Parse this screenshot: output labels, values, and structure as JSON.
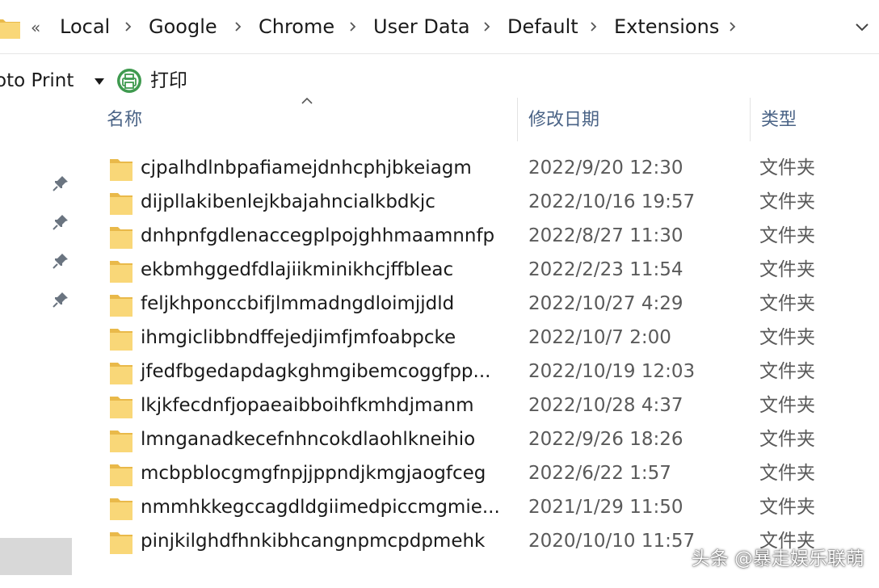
{
  "address_bar": {
    "overflow": "«",
    "crumbs": [
      "Local",
      "Google",
      "Chrome",
      "User Data",
      "Default",
      "Extensions"
    ]
  },
  "command_bar": {
    "photo_print_label": "oto Print",
    "print_label": "打印"
  },
  "columns": {
    "name": "名称",
    "date": "修改日期",
    "type": "类型"
  },
  "files": [
    {
      "name": "cjpalhdlnbpafiamejdnhcphjbkeiagm",
      "date": "2022/9/20 12:30",
      "type": "文件夹"
    },
    {
      "name": "dijpllakibenlejkbajahncialkbdkjc",
      "date": "2022/10/16 19:57",
      "type": "文件夹"
    },
    {
      "name": "dnhpnfgdlenaccegplpojghhmaamnnfp",
      "date": "2022/8/27 11:30",
      "type": "文件夹"
    },
    {
      "name": "ekbmhggedfdlajiikminikhcjffbleac",
      "date": "2022/2/23 11:54",
      "type": "文件夹"
    },
    {
      "name": "feljkhponccbifjlmmadngdloimjjdld",
      "date": "2022/10/27 4:29",
      "type": "文件夹"
    },
    {
      "name": "ihmgiclibbndffejedjimfjmfoabpcke",
      "date": "2022/10/7 2:00",
      "type": "文件夹"
    },
    {
      "name": "jfedfbgedapdagkghmgibemcoggfpp...",
      "date": "2022/10/19 12:03",
      "type": "文件夹"
    },
    {
      "name": "lkjkfecdnfjopaeaibboihfkmhdjmanm",
      "date": "2022/10/28 4:37",
      "type": "文件夹"
    },
    {
      "name": "lmnganadkecefnhncokdlaohlkneihio",
      "date": "2022/9/26 18:26",
      "type": "文件夹"
    },
    {
      "name": "mcbpblocgmgfnpjjppndjkmgjaogfceg",
      "date": "2022/6/22 1:57",
      "type": "文件夹"
    },
    {
      "name": "nmmhkkegccagdldgiimedpiccmgmie...",
      "date": "2021/1/29 11:50",
      "type": "文件夹"
    },
    {
      "name": "pinjkilghdfhnkibhcangnpmcpdpmehk",
      "date": "2020/10/10 11:57",
      "type": "文件夹"
    }
  ],
  "watermark": "头条 @暴走娱乐联萌",
  "colors": {
    "folder_body": "#f9d778",
    "folder_tab": "#e9b94a",
    "header_text": "#4a6386",
    "print_icon": "#3f9a4f"
  },
  "icons": {
    "folder": "folder-icon",
    "chevron": "chevron-right-icon",
    "pin": "pin-icon",
    "print": "printer-icon",
    "dropdown": "chevron-down-icon",
    "sort": "sort-ascending-icon"
  }
}
